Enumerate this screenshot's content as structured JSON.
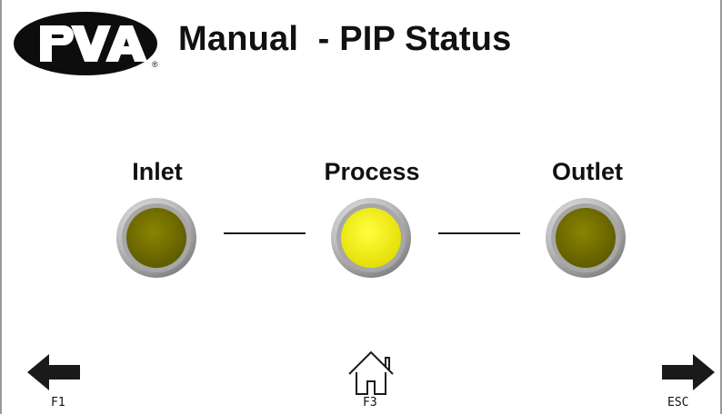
{
  "header": {
    "brand": "PVA",
    "title": "Manual  - PIP Status"
  },
  "colors": {
    "lamp_off": "#7a7600",
    "lamp_on": "#f4f000",
    "lamp_ring": "#9a9a9a"
  },
  "stations": [
    {
      "label": "Inlet",
      "state": "off"
    },
    {
      "label": "Process",
      "state": "on"
    },
    {
      "label": "Outlet",
      "state": "off"
    }
  ],
  "nav": {
    "back_key": "F1",
    "home_key": "F3",
    "forward_key": "ESC"
  }
}
